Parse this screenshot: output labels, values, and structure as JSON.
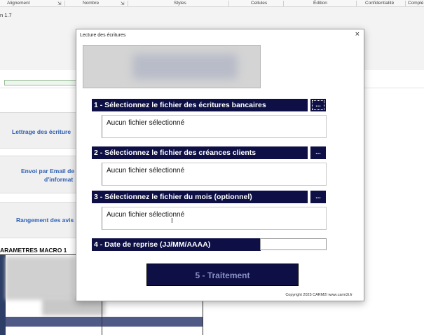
{
  "ribbon": {
    "groups": [
      "Alignement",
      "Nombre",
      "Styles",
      "Cellules",
      "Édition",
      "Confidentialité",
      "Complé"
    ]
  },
  "sheet": {
    "version_label": "n 1.7",
    "macro_buttons": [
      {
        "line1": "Lettrage des écriture",
        "line2": ""
      },
      {
        "line1": "Envoi par Email de",
        "line2": "d'informat"
      },
      {
        "line1": "Rangement des avis",
        "line2": ""
      }
    ],
    "params_title": "ARAMETRES MACRO 1"
  },
  "dialog": {
    "title": "Lecture des écritures",
    "close_glyph": "×",
    "steps": [
      {
        "label": "1 - Sélectionnez le fichier des écritures bancaires",
        "browse": "...",
        "file": "Aucun fichier sélectionné"
      },
      {
        "label": "2 - Sélectionnez le fichier des créances clients",
        "browse": "...",
        "file": "Aucun fichier sélectionné"
      },
      {
        "label": "3 - Sélectionnez le fichier du mois (optionnel)",
        "browse": "...",
        "file": "Aucun fichier sélectionné"
      }
    ],
    "date_label": "4 - Date de reprise  (JJ/MM/AAAA)",
    "date_value": "",
    "process_label": "5 - Traitement",
    "copyright": "Copyright 2025 CARM2I www.carm2i.fr"
  },
  "icons": {
    "close": "close-icon",
    "dialog_launcher": "dialog-launcher-icon",
    "text_cursor": "text-cursor-icon"
  },
  "colors": {
    "dialog_navy": "#0d0f45",
    "process_text": "#8a91c4",
    "macro_link": "#2f5fb3"
  }
}
